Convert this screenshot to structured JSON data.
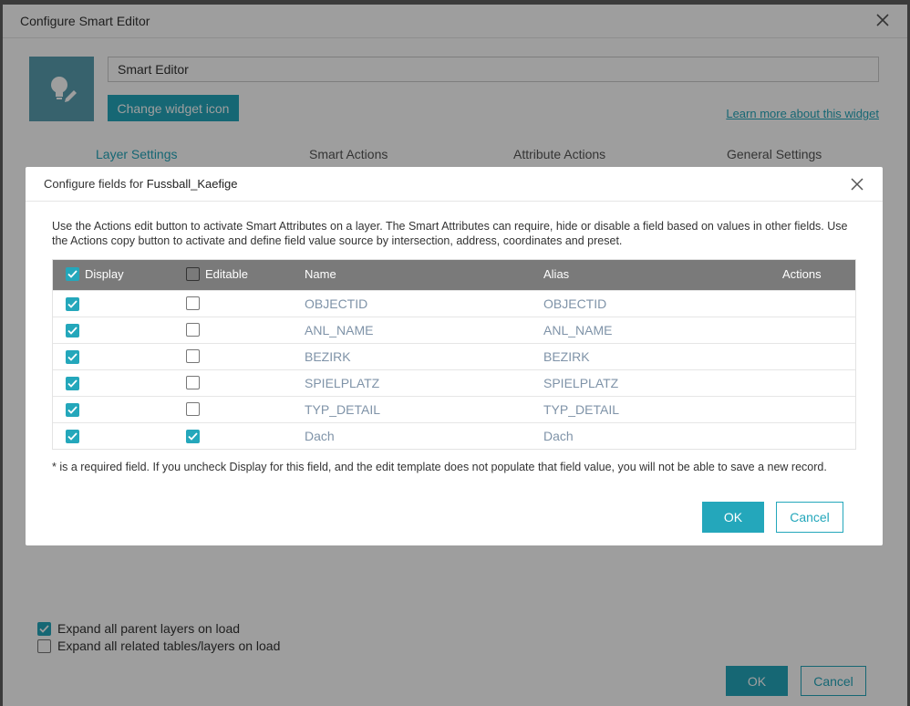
{
  "outer": {
    "title": "Configure Smart Editor",
    "widget_name": "Smart Editor",
    "change_icon_label": "Change widget icon",
    "learn_more": "Learn more about this widget",
    "tabs": [
      "Layer Settings",
      "Smart Actions",
      "Attribute Actions",
      "General Settings"
    ],
    "active_tab": "Layer Settings",
    "expand_parent_label": "Expand all parent layers on load",
    "expand_parent_checked": true,
    "expand_related_label": "Expand all related tables/layers on load",
    "expand_related_checked": false,
    "ok_label": "OK",
    "cancel_label": "Cancel"
  },
  "dialog": {
    "title_prefix": "Configure fields for ",
    "layer_name": "Fussball_Kaefige",
    "description": "Use the Actions edit button to activate Smart Attributes on a layer. The Smart Attributes can require, hide or disable a field based on values in other fields. Use the Actions copy button to activate and define field value source by intersection, address, coordinates and preset.",
    "columns": {
      "display": "Display",
      "editable": "Editable",
      "name": "Name",
      "alias": "Alias",
      "actions": "Actions"
    },
    "header_display_checked": true,
    "header_editable_checked": false,
    "rows": [
      {
        "name": "OBJECTID",
        "alias": "OBJECTID",
        "display": true,
        "editable": false
      },
      {
        "name": "ANL_NAME",
        "alias": "ANL_NAME",
        "display": true,
        "editable": false
      },
      {
        "name": "BEZIRK",
        "alias": "BEZIRK",
        "display": true,
        "editable": false
      },
      {
        "name": "SPIELPLATZ",
        "alias": "SPIELPLATZ",
        "display": true,
        "editable": false
      },
      {
        "name": "TYP_DETAIL",
        "alias": "TYP_DETAIL",
        "display": true,
        "editable": false
      },
      {
        "name": "Dach",
        "alias": "Dach",
        "display": true,
        "editable": true
      }
    ],
    "note": "* is a required field. If you uncheck Display for this field, and the edit template does not populate that field value, you will not be able to save a new record.",
    "ok_label": "OK",
    "cancel_label": "Cancel"
  },
  "colors": {
    "accent": "#24a7bb",
    "header_bg": "#7a7a7a",
    "widget_icon_bg": "#5a9fb0"
  }
}
